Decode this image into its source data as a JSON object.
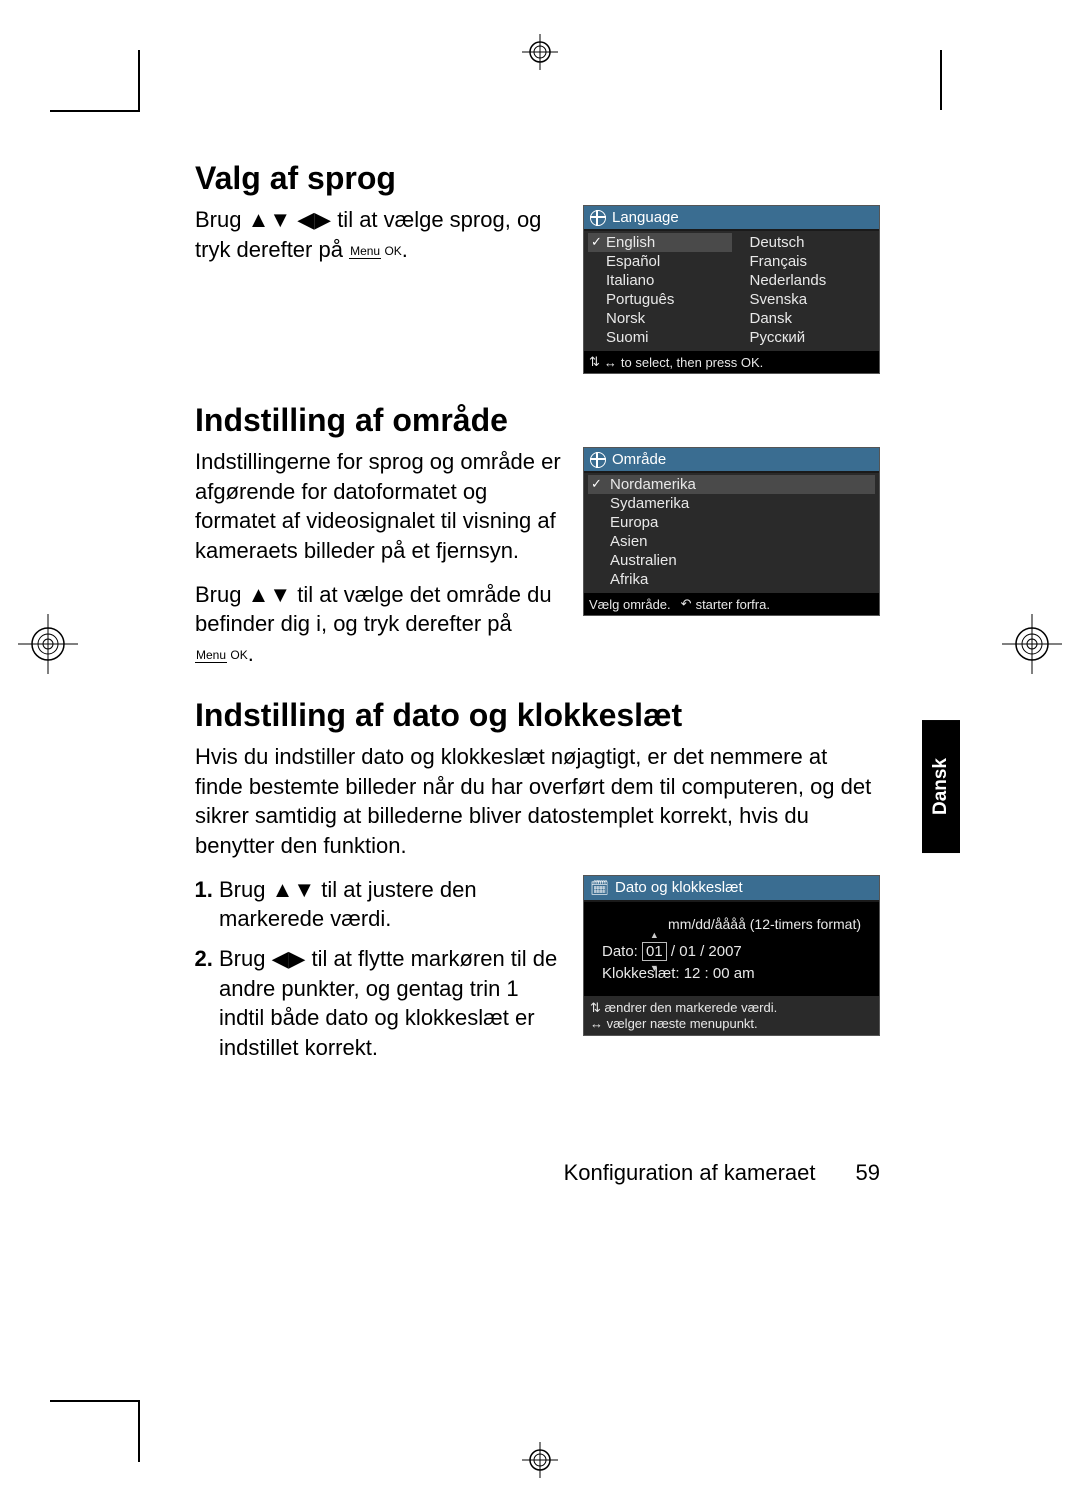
{
  "headings": {
    "h1": "Valg af sprog",
    "h2": "Indstilling af område",
    "h3": "Indstilling af dato og klokkeslæt"
  },
  "section1": {
    "p": "Brug ▲▼ ◀▶ til at vælge sprog, og tryk derefter på ",
    "menu_top": "Menu",
    "menu_bot": "OK",
    "p_end": "."
  },
  "lcd_lang": {
    "title": "Language",
    "rows": [
      [
        "English",
        "Deutsch"
      ],
      [
        "Español",
        "Français"
      ],
      [
        "Italiano",
        "Nederlands"
      ],
      [
        "Português",
        "Svenska"
      ],
      [
        "Norsk",
        "Dansk"
      ],
      [
        "Suomi",
        "Русский"
      ]
    ],
    "selected": "English",
    "hint": "to select, then press OK."
  },
  "section2": {
    "p1": "Indstillingerne for sprog og område er afgørende for datoformatet og formatet af videosignalet til visning af kameraets billeder på et fjernsyn.",
    "p2a": "Brug ▲▼ til at vælge det område du befinder dig i, og tryk derefter på ",
    "menu_top": "Menu",
    "menu_bot": "OK",
    "p2b": "."
  },
  "lcd_region": {
    "title": "Område",
    "items": [
      "Nordamerika",
      "Sydamerika",
      "Europa",
      "Asien",
      "Australien",
      "Afrika"
    ],
    "selected": "Nordamerika",
    "hint_a": "Vælg område.",
    "hint_b": "starter forfra."
  },
  "section3": {
    "p": "Hvis du indstiller dato og klokkeslæt nøjagtigt, er det nemmere at finde bestemte billeder når du har overført dem til computeren, og det sikrer samtidig at billederne bliver datostemplet korrekt, hvis du benytter den funktion.",
    "step1": "Brug ▲▼ til at justere den markerede værdi.",
    "step2": "Brug ◀▶ til at flytte markøren til de andre punkter, og gentag trin 1 indtil både dato og klokkeslæt er indstillet korrekt."
  },
  "lcd_date": {
    "title": "Dato og klokkeslæt",
    "format": "mm/dd/åååå (12-timers format)",
    "date_label": "Dato:",
    "date_box": "01",
    "date_rest": " / 01 / 2007",
    "time_label": "Klokkeslæt:",
    "time_value": "12 : 00  am",
    "hint1": "ændrer den markerede værdi.",
    "hint2": "vælger næste menupunkt."
  },
  "side_tab": "Dansk",
  "footer": {
    "chapter": "Konfiguration af kameraet",
    "page": "59"
  }
}
